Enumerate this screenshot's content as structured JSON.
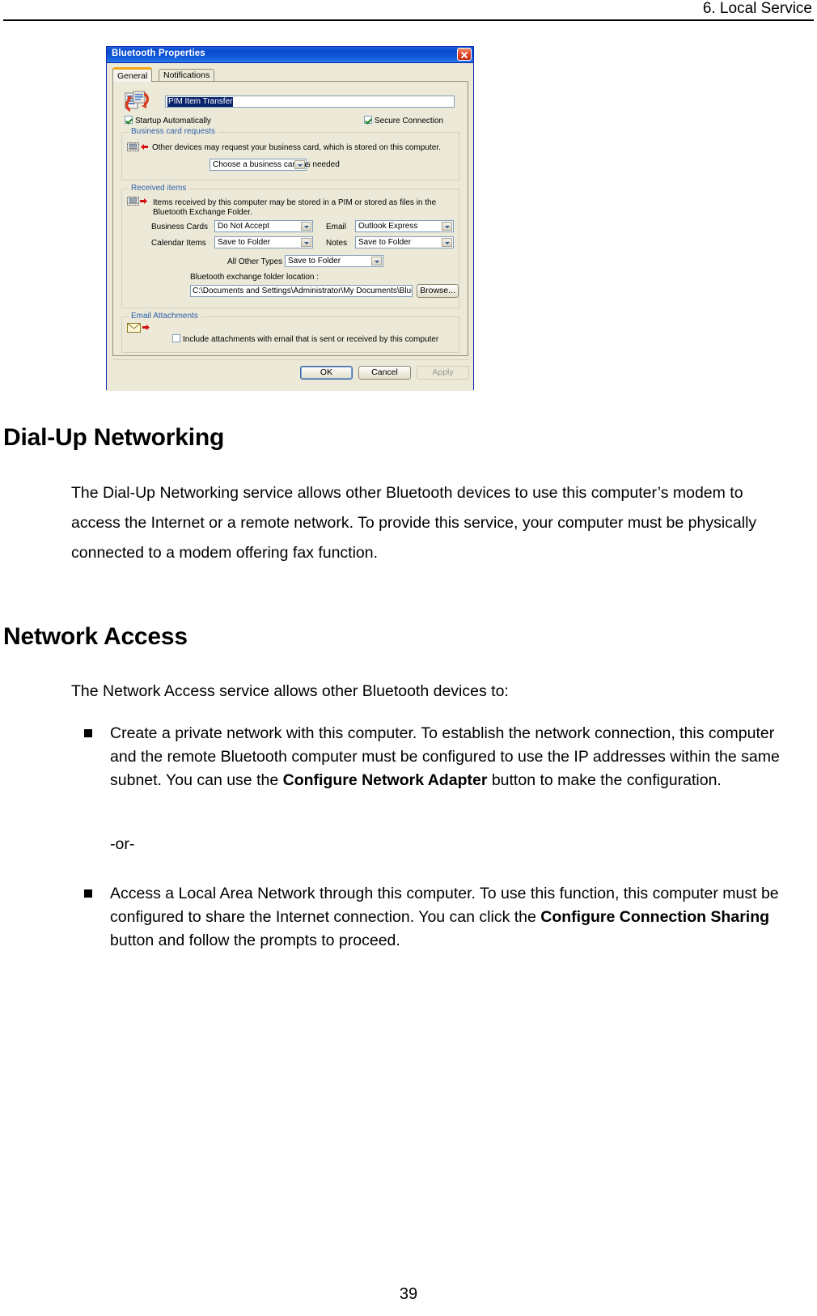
{
  "page": {
    "header_text": "6. Local Service",
    "page_number": "39"
  },
  "dialog": {
    "title": "Bluetooth Properties",
    "close_icon": "close-icon",
    "tabs": [
      {
        "label": "General",
        "active": true
      },
      {
        "label": "Notifications",
        "active": false
      }
    ],
    "service_icon": "pim-item-transfer-icon",
    "service_name_value": "PIM Item Transfer",
    "checkboxes": [
      {
        "label": "Startup Automatically",
        "checked": true
      },
      {
        "label": "Secure Connection",
        "checked": true
      }
    ],
    "business_card_group": {
      "title": "Business card requests",
      "icon": "device-incoming-icon",
      "description": "Other devices may request your business card, which is stored on this computer.",
      "combo_value": "Choose a business card as needed"
    },
    "received_items_group": {
      "title": "Received items",
      "icon": "device-outgoing-icon",
      "description_line1": "Items received by this computer may be stored in a PIM or stored as files in the",
      "description_line2": "Bluetooth Exchange Folder.",
      "fields": [
        {
          "label": "Business Cards",
          "value": "Do Not Accept"
        },
        {
          "label": "Email",
          "value": "Outlook Express"
        },
        {
          "label": "Calendar Items",
          "value": "Save to Folder"
        },
        {
          "label": "Notes",
          "value": "Save to Folder"
        },
        {
          "label": "All Other Types",
          "value": "Save to Folder"
        }
      ],
      "folder_label": "Bluetooth exchange folder location :",
      "folder_path": "C:\\Documents and Settings\\Administrator\\My Documents\\Bluetooth",
      "browse_label": "Browse..."
    },
    "email_attachments_group": {
      "title": "Email Attachments",
      "icon": "envelope-icon",
      "checkbox_label": "Include attachments with email that is sent or received by this computer",
      "checked": false
    },
    "buttons": {
      "ok": "OK",
      "cancel": "Cancel",
      "apply": "Apply"
    }
  },
  "content": {
    "heading_dialup": "Dial-Up Networking",
    "para_dialup": "The Dial-Up Networking service allows other Bluetooth devices to use this computer’s modem to access the Internet or a remote network. To provide this service, your computer must be physically connected to a modem offering fax function.",
    "heading_network": "Network Access",
    "para_network": "The Network Access service allows other Bluetooth devices to:",
    "bullet1_pre": "Create a private network with this computer. To establish the network connection, this computer and the remote Bluetooth computer must be configured to use the IP addresses within the same subnet. You can use the ",
    "bullet1_bold": "Configure Network Adapter",
    "bullet1_post": " button to make the configuration.",
    "or_text": "-or-",
    "bullet2_pre": "Access a Local Area Network through this computer. To use this function, this computer must be configured to share the Internet connection. You can click the ",
    "bullet2_bold": "Configure Connection Sharing",
    "bullet2_post": " button and follow the prompts to proceed."
  }
}
